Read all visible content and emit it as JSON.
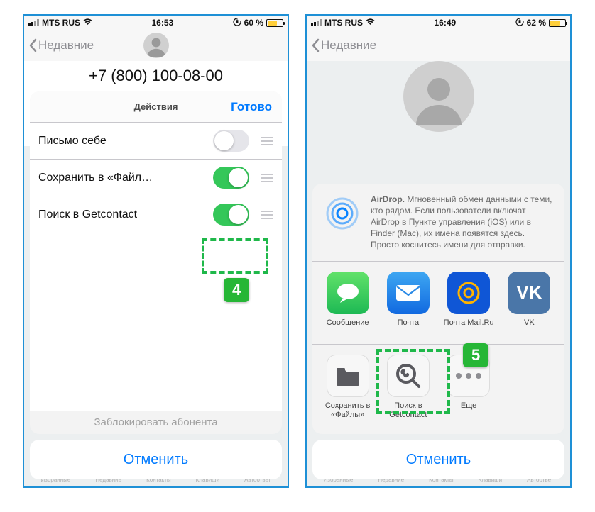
{
  "left": {
    "status": {
      "carrier": "MTS RUS",
      "time": "16:53",
      "battery": "60 %"
    },
    "nav_back": "Недавние",
    "phone_number": "+7 (800) 100-08-00",
    "sheet": {
      "title": "Действия",
      "done": "Готово",
      "rows": [
        {
          "label": "Письмо себе",
          "on": false
        },
        {
          "label": "Сохранить в «Файл…",
          "on": true
        },
        {
          "label": "Поиск в Getcontact",
          "on": true
        }
      ]
    },
    "blocked_hint": "Заблокировать абонента",
    "cancel": "Отменить",
    "callout": "4"
  },
  "right": {
    "status": {
      "carrier": "MTS RUS",
      "time": "16:49",
      "battery": "62 %"
    },
    "nav_back": "Недавние",
    "airdrop": {
      "title": "AirDrop.",
      "body": "Мгновенный обмен данными с теми, кто рядом. Если пользователи включат AirDrop в Пункте управления (iOS) или в Finder (Mac), их имена появятся здесь. Просто коснитесь имени для отправки."
    },
    "apps": [
      {
        "name": "Сообщение",
        "icon": "messages"
      },
      {
        "name": "Почта",
        "icon": "mail"
      },
      {
        "name": "Почта Mail.Ru",
        "icon": "mailru"
      },
      {
        "name": "VK",
        "icon": "vk"
      }
    ],
    "activities": [
      {
        "name": "Сохранить в «Файлы»",
        "icon": "folder"
      },
      {
        "name": "Поиск в Getcontact",
        "icon": "getcontact"
      },
      {
        "name": "Еще",
        "icon": "more"
      }
    ],
    "cancel": "Отменить",
    "callout": "5"
  },
  "tabbar": [
    "Избранные",
    "Недавние",
    "Контакты",
    "Клавиши",
    "Автоответ"
  ]
}
